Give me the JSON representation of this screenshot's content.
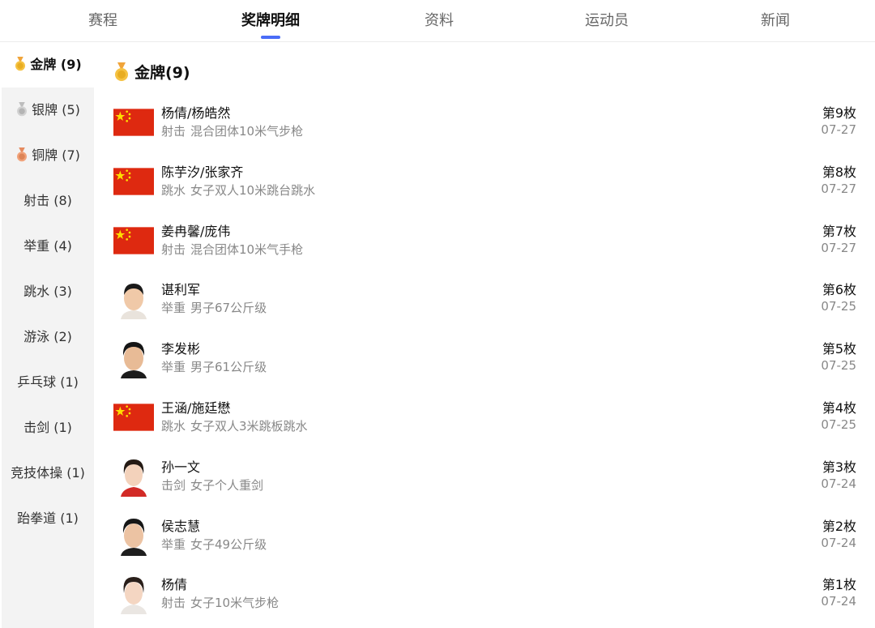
{
  "tabs": [
    {
      "label": "赛程",
      "active": false
    },
    {
      "label": "奖牌明细",
      "active": true
    },
    {
      "label": "资料",
      "active": false
    },
    {
      "label": "运动员",
      "active": false
    },
    {
      "label": "新闻",
      "active": false
    }
  ],
  "accent_color": "#4a6cf7",
  "sidebar": {
    "items": [
      {
        "label": "金牌 (9)",
        "icon": "gold-medal-icon",
        "active": true
      },
      {
        "label": "银牌 (5)",
        "icon": "silver-medal-icon",
        "active": false
      },
      {
        "label": "铜牌 (7)",
        "icon": "bronze-medal-icon",
        "active": false
      },
      {
        "label": "射击 (8)",
        "icon": null,
        "active": false
      },
      {
        "label": "举重 (4)",
        "icon": null,
        "active": false
      },
      {
        "label": "跳水 (3)",
        "icon": null,
        "active": false
      },
      {
        "label": "游泳 (2)",
        "icon": null,
        "active": false
      },
      {
        "label": "乒乓球 (1)",
        "icon": null,
        "active": false
      },
      {
        "label": "击剑 (1)",
        "icon": null,
        "active": false
      },
      {
        "label": "竞技体操 (1)",
        "icon": null,
        "active": false
      },
      {
        "label": "跆拳道 (1)",
        "icon": null,
        "active": false
      }
    ]
  },
  "main": {
    "title": "金牌(9)",
    "title_icon": "gold-medal-icon",
    "medals": [
      {
        "name": "杨倩/杨皓然",
        "sport": "射击",
        "event": "混合团体10米气步枪",
        "rank": "第9枚",
        "date": "07-27",
        "thumb": "flag"
      },
      {
        "name": "陈芋汐/张家齐",
        "sport": "跳水",
        "event": "女子双人10米跳台跳水",
        "rank": "第8枚",
        "date": "07-27",
        "thumb": "flag"
      },
      {
        "name": "姜冉馨/庞伟",
        "sport": "射击",
        "event": "混合团体10米气手枪",
        "rank": "第7枚",
        "date": "07-27",
        "thumb": "flag"
      },
      {
        "name": "谌利军",
        "sport": "举重",
        "event": "男子67公斤级",
        "rank": "第6枚",
        "date": "07-25",
        "thumb": "photo"
      },
      {
        "name": "李发彬",
        "sport": "举重",
        "event": "男子61公斤级",
        "rank": "第5枚",
        "date": "07-25",
        "thumb": "photo"
      },
      {
        "name": "王涵/施廷懋",
        "sport": "跳水",
        "event": "女子双人3米跳板跳水",
        "rank": "第4枚",
        "date": "07-25",
        "thumb": "flag"
      },
      {
        "name": "孙一文",
        "sport": "击剑",
        "event": "女子个人重剑",
        "rank": "第3枚",
        "date": "07-24",
        "thumb": "photo"
      },
      {
        "name": "侯志慧",
        "sport": "举重",
        "event": "女子49公斤级",
        "rank": "第2枚",
        "date": "07-24",
        "thumb": "photo"
      },
      {
        "name": "杨倩",
        "sport": "射击",
        "event": "女子10米气步枪",
        "rank": "第1枚",
        "date": "07-24",
        "thumb": "photo"
      }
    ]
  }
}
